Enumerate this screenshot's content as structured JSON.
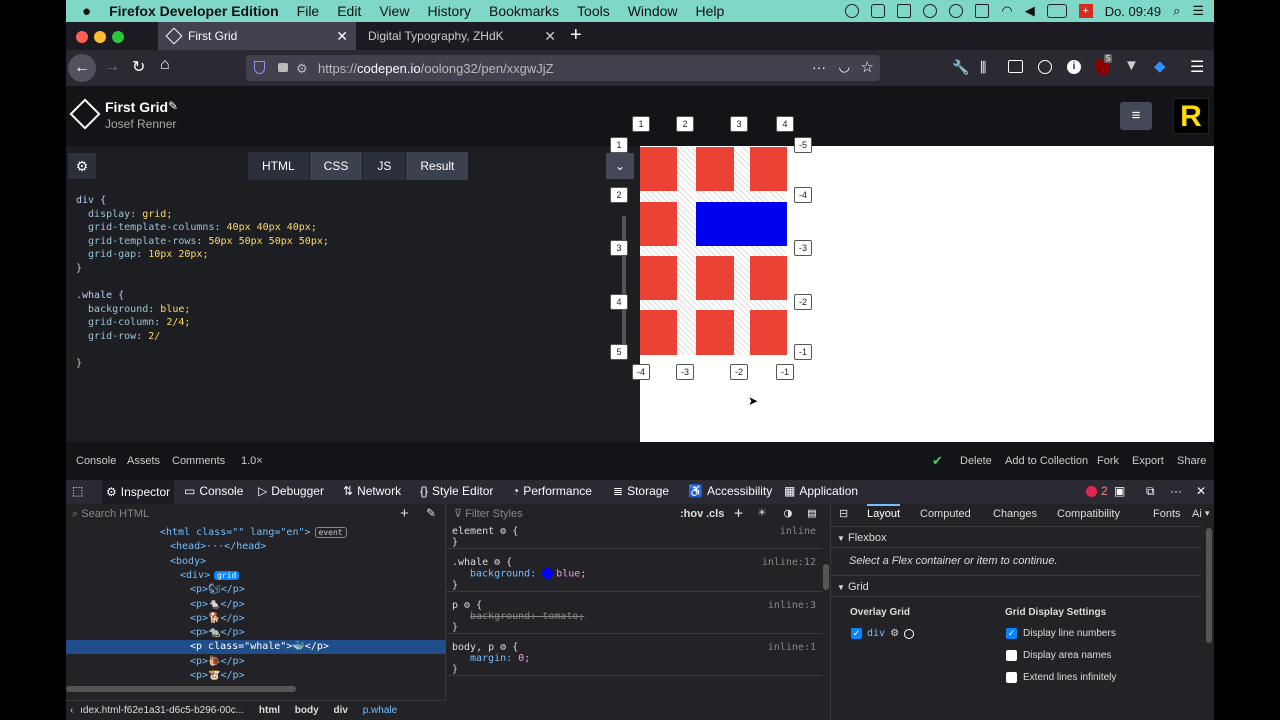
{
  "menubar": {
    "app": "Firefox Developer Edition",
    "items": [
      "File",
      "Edit",
      "View",
      "History",
      "Bookmarks",
      "Tools",
      "Window",
      "Help"
    ],
    "clock": "Do. 09:49"
  },
  "tabs": [
    {
      "title": "First Grid"
    },
    {
      "title": "Digital Typography, ZHdK"
    }
  ],
  "url": {
    "prefix": "https://",
    "host": "codepen.io",
    "path": "/oolong32/pen/xxgwJjZ"
  },
  "pen": {
    "title": "First Grid",
    "author": "Josef Renner"
  },
  "editor_tabs": [
    "HTML",
    "CSS",
    "JS",
    "Result"
  ],
  "code": [
    {
      "t": "sel",
      "s": "div {"
    },
    {
      "t": "decl",
      "p": "display",
      "v": "grid;"
    },
    {
      "t": "decl",
      "p": "grid-template-columns",
      "v": "40px 40px 40px;"
    },
    {
      "t": "decl",
      "p": "grid-template-rows",
      "v": "50px 50px 50px 50px;"
    },
    {
      "t": "decl",
      "p": "grid-gap",
      "v": "10px 20px;"
    },
    {
      "t": "plain",
      "s": "}"
    },
    {
      "t": "plain",
      "s": ""
    },
    {
      "t": "sel",
      "s": ".whale {"
    },
    {
      "t": "decl",
      "p": "background",
      "v": "blue;"
    },
    {
      "t": "decl",
      "p": "grid-column",
      "v": "2/4;"
    },
    {
      "t": "decl",
      "p": "grid-row",
      "v": "2/"
    },
    {
      "t": "plain",
      "s": ""
    },
    {
      "t": "plain",
      "s": "}"
    }
  ],
  "grid_labels": {
    "cols_top": [
      "1",
      "2",
      "3",
      "4"
    ],
    "cols_bottom": [
      "-4",
      "-3",
      "-2",
      "-1"
    ],
    "rows_left": [
      "1",
      "2",
      "3",
      "4",
      "5"
    ],
    "rows_right": [
      "-5",
      "-4",
      "-3",
      "-2",
      "-1"
    ]
  },
  "footer": {
    "left": [
      "Console",
      "Assets",
      "Comments",
      "1.0×"
    ],
    "right": [
      "Delete",
      "Add to Collection",
      "Fork",
      "Export",
      "Share"
    ]
  },
  "devtools": {
    "tabs": [
      "Inspector",
      "Console",
      "Debugger",
      "Network",
      "Style Editor",
      "Performance",
      "Storage",
      "Accessibility",
      "Application"
    ],
    "error_count": "2"
  },
  "search_html": "Search HTML",
  "filter_styles": "Filter Styles",
  "hov": ":hov",
  "cls": ".cls",
  "tree": [
    {
      "indent": 0,
      "html": "<html class=\"\" lang=\"en\">",
      "badge": "event"
    },
    {
      "indent": 1,
      "html": "<head>···</head>"
    },
    {
      "indent": 1,
      "html": "<body>"
    },
    {
      "indent": 2,
      "html": "<div>",
      "badge": "grid"
    },
    {
      "indent": 3,
      "html": "<p>🐿</p>"
    },
    {
      "indent": 3,
      "html": "<p>🐁</p>"
    },
    {
      "indent": 3,
      "html": "<p>🐕</p>"
    },
    {
      "indent": 3,
      "html": "<p>🐀</p>"
    },
    {
      "indent": 3,
      "html": "<p class=\"whale\">🐳</p>",
      "selected": true
    },
    {
      "indent": 3,
      "html": "<p>🐌</p>"
    },
    {
      "indent": 3,
      "html": "<p>🐮</p>"
    }
  ],
  "breadcrumbs": [
    "ıdex.html-f62e1a31-d6c5-b296-00c...",
    "html",
    "body",
    "div",
    "p.whale"
  ],
  "rules": [
    {
      "sel": "element",
      "src": "inline",
      "decls": []
    },
    {
      "sel": ".whale",
      "src": "inline:12",
      "decls": [
        {
          "p": "background",
          "v": "blue;",
          "swatch": "#0000ff"
        }
      ]
    },
    {
      "sel": "p",
      "src": "inline:3",
      "decls": [
        {
          "p": "background",
          "v": "tomato;",
          "struck": true
        }
      ]
    },
    {
      "sel": "body, p",
      "src": "inline:1",
      "decls": [
        {
          "p": "margin",
          "v": "0;"
        }
      ]
    }
  ],
  "layout_tabs": [
    "Layout",
    "Computed",
    "Changes",
    "Compatibility",
    "Fonts",
    "Ai"
  ],
  "flexbox": {
    "title": "Flexbox",
    "hint": "Select a Flex container or item to continue."
  },
  "gridsec": {
    "title": "Grid",
    "overlay_title": "Overlay Grid",
    "overlay_item": "div",
    "settings_title": "Grid Display Settings",
    "settings": [
      {
        "label": "Display line numbers",
        "checked": true
      },
      {
        "label": "Display area names",
        "checked": false
      },
      {
        "label": "Extend lines infinitely",
        "checked": false
      }
    ]
  }
}
